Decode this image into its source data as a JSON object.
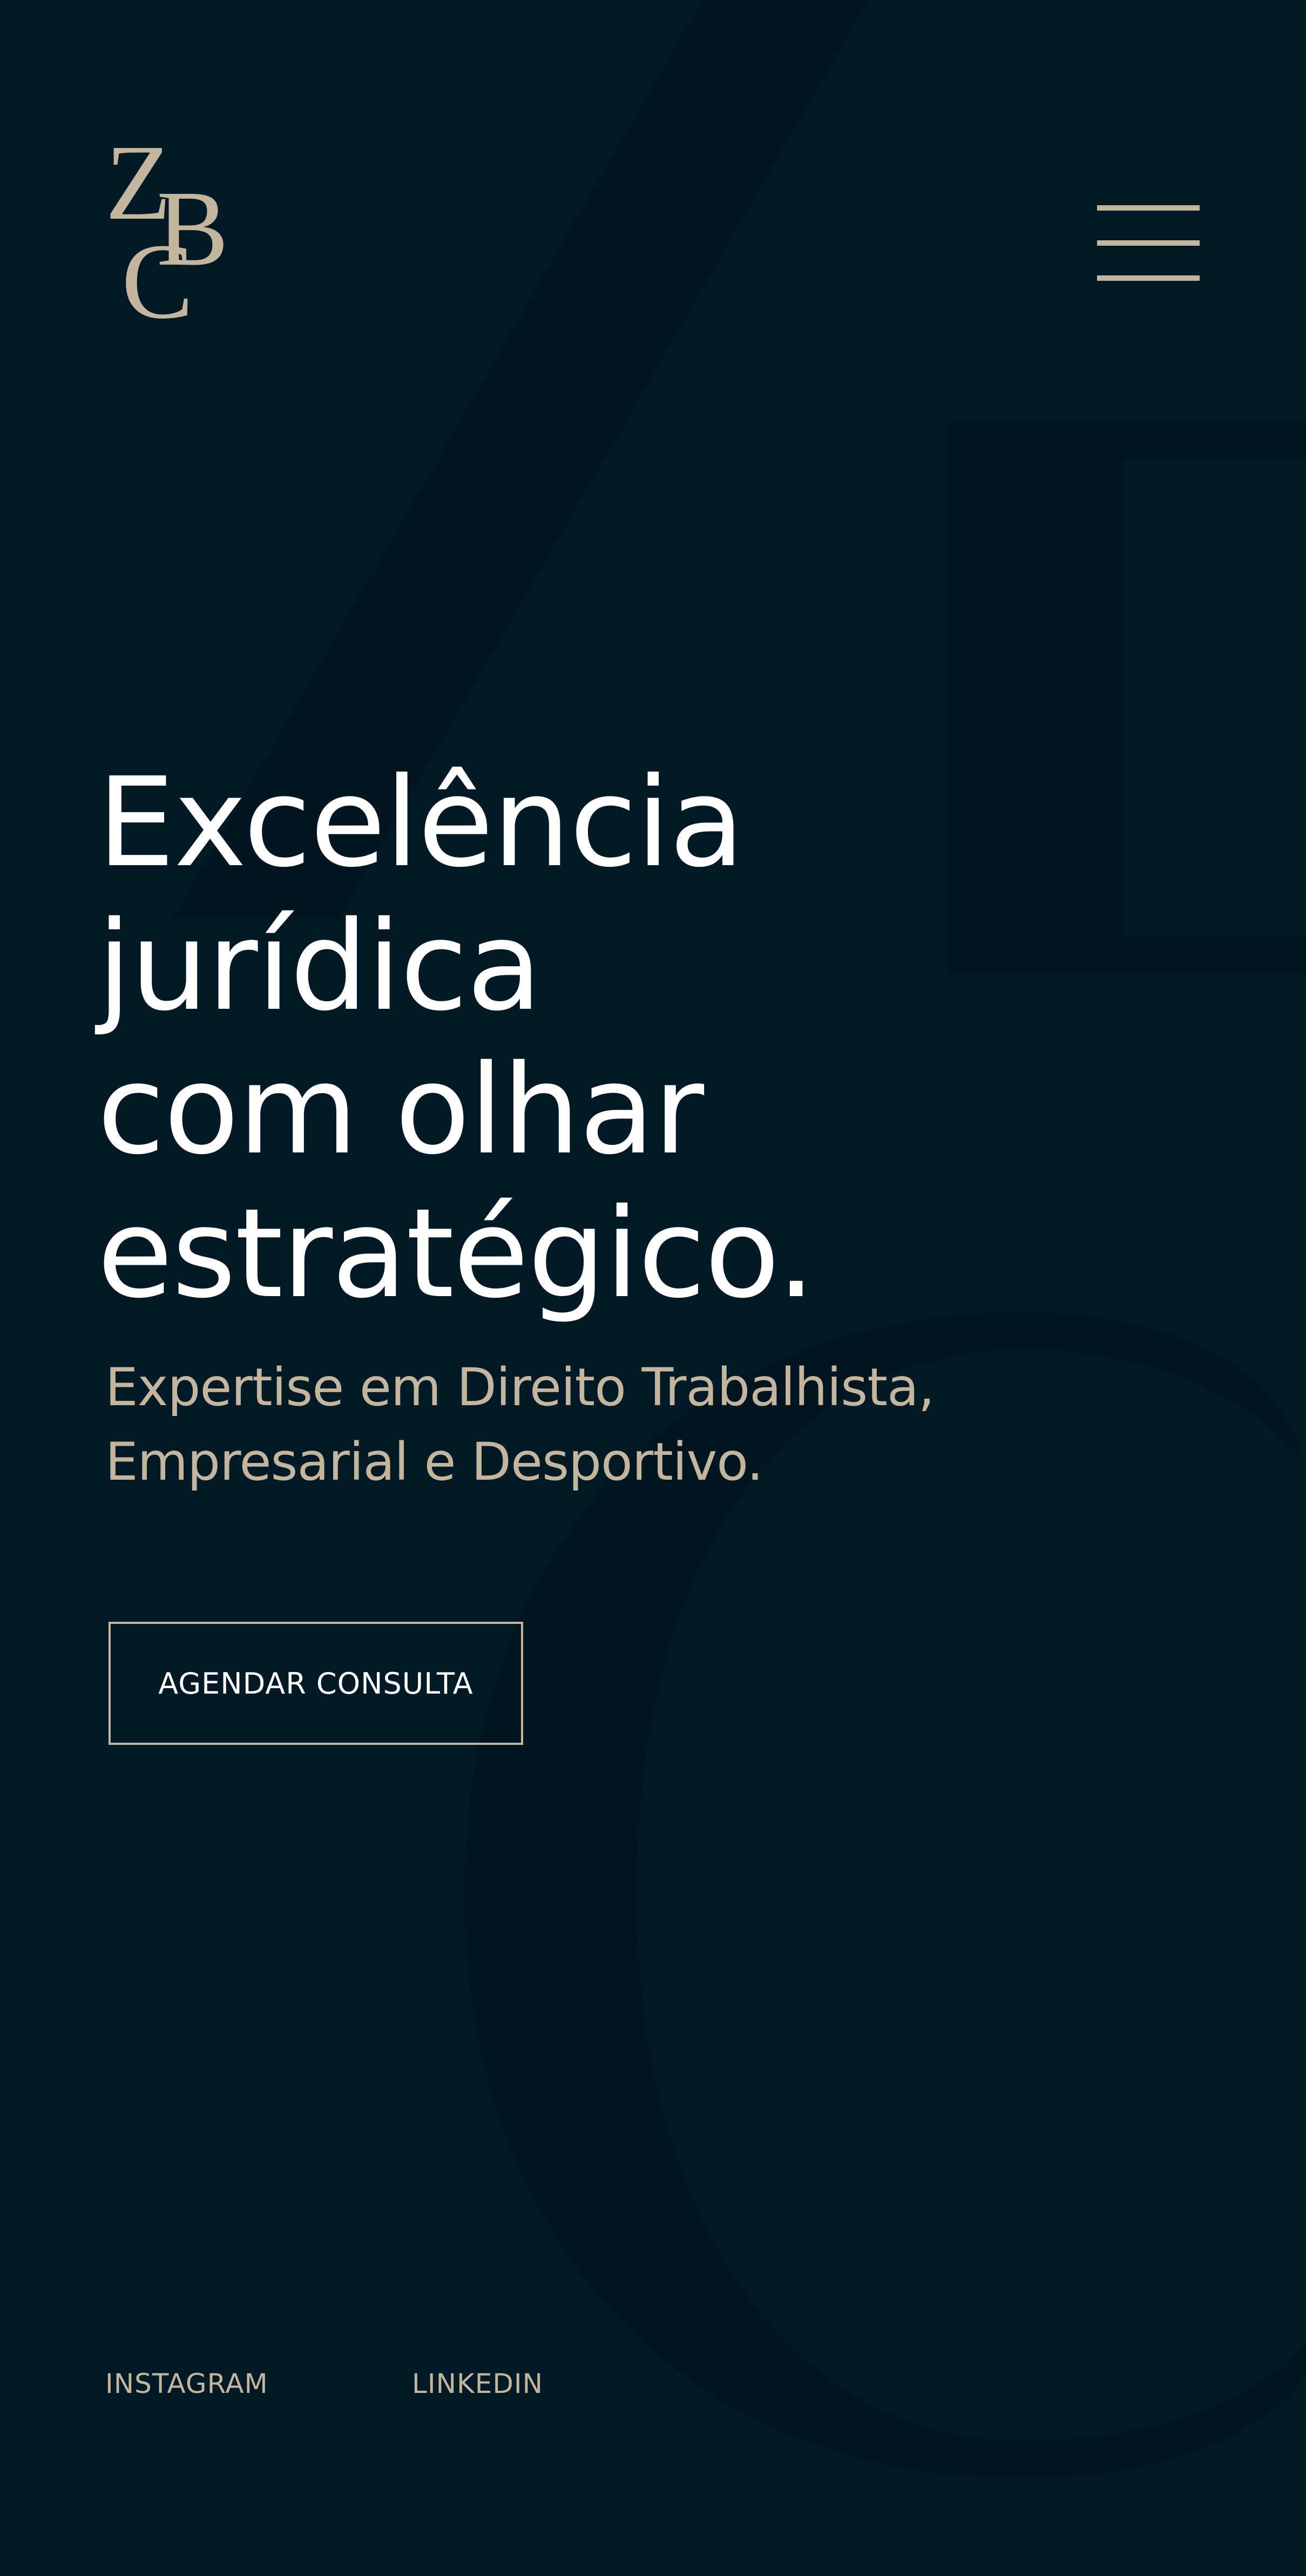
{
  "brand": {
    "logo_letters": [
      "Z",
      "B",
      "C"
    ]
  },
  "header": {
    "menu_icon": "hamburger-menu-icon"
  },
  "hero": {
    "headline_lines": [
      "Excelência",
      "jurídica",
      "com olhar",
      "estratégico."
    ],
    "subtitle_lines": [
      "Expertise em Direito Trabalhista,",
      "Empresarial e Desportivo."
    ],
    "cta_label": "AGENDAR CONSULTA"
  },
  "social": {
    "links": [
      {
        "label": "INSTAGRAM"
      },
      {
        "label": "LINKEDIN"
      }
    ]
  },
  "colors": {
    "background": "#021926",
    "background_shape": "#01141c",
    "accent_gold": "#c4b59d",
    "headline_text": "#ffffff"
  }
}
